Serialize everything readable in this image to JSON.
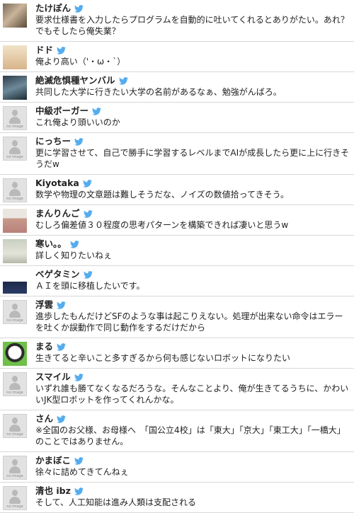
{
  "feed": {
    "tweets": [
      {
        "name": "たけぽん",
        "text": "要求仕様書を入力したらプログラムを自動的に吐いてくれるとありがたい。あれ？でもそしたら俺失業？",
        "avatar": "photo"
      },
      {
        "name": "ドド",
        "text": "俺より高い（'・ω・`）",
        "avatar": "photo"
      },
      {
        "name": "絶滅危惧種ヤンバル",
        "text": "共同した大学に行きたい大学の名前があるなぁ、勉強がんばろ。",
        "avatar": "photo"
      },
      {
        "name": "中級ボーガー",
        "text": "これ俺より頭いいのか",
        "avatar": "no-image"
      },
      {
        "name": "にっちー",
        "text": "更に学習させて、自己で勝手に学習するレベルまでAIが成長したら更に上に行きそうだw",
        "avatar": "no-image"
      },
      {
        "name": "Kiyotaka",
        "text": "数学や物理の文章題は難しそうだな、ノイズの数値拾ってきそう。",
        "avatar": "no-image"
      },
      {
        "name": "まんりんご",
        "text": "むしろ偏差値３０程度の思考パターンを構築できれば凄いと思うw",
        "avatar": "photo"
      },
      {
        "name": "寒い。。",
        "text": "詳しく知りたいねぇ",
        "avatar": "photo"
      },
      {
        "name": "ベゲタミン",
        "text": "ＡＩを頭に移植したいです。",
        "avatar": "photo"
      },
      {
        "name": "浮雲",
        "text": "進歩したもんだけどSFのような事は起こりえない。処理が出来ない命令はエラーを吐くか誤動作で同じ動作をするだけだから",
        "avatar": "no-image"
      },
      {
        "name": "まる",
        "text": "生きてると辛いこと多すぎるから何も感じないロボットになりたい",
        "avatar": "photo"
      },
      {
        "name": "スマイル",
        "text": "いずれ誰も勝てなくなるだろうな。そんなことより、俺が生きてるうちに、かわいいJK型ロボットを作ってくれんかな。",
        "avatar": "no-image"
      },
      {
        "name": "さん",
        "text": "※全国のお父様、お母様へ　「国公立4校」は「東大」「京大」「東工大」「一橋大」のことではありません。",
        "avatar": "no-image"
      },
      {
        "name": "かまぼこ",
        "text": "徐々に詰めてきてんねぇ",
        "avatar": "no-image"
      },
      {
        "name": "清也 ibz",
        "text": "そして、人工知能は進み人類は支配される",
        "avatar": "no-image"
      }
    ],
    "no_image_label": "no image",
    "bird_color": "#55acee"
  }
}
